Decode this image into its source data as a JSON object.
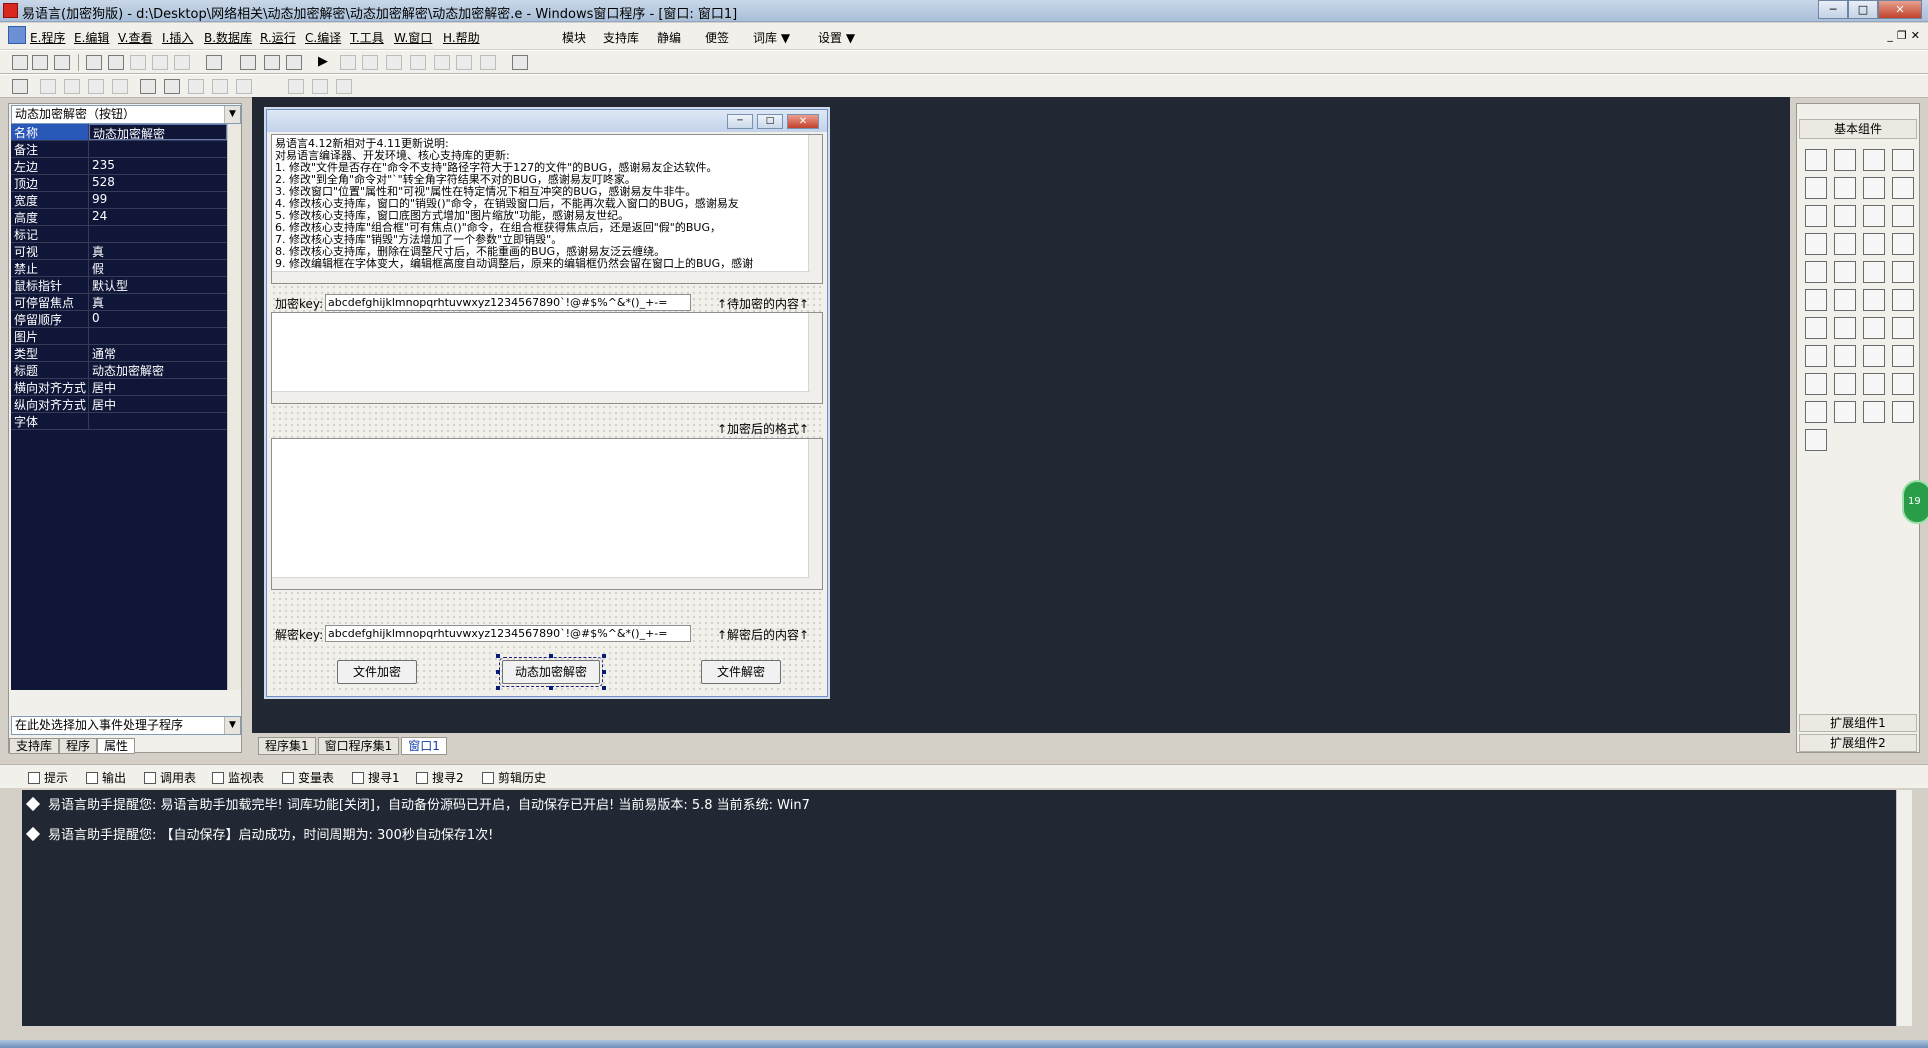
{
  "window": {
    "title": "易语言(加密狗版) - d:\\Desktop\\网络相关\\动态加密解密\\动态加密解密\\动态加密解密.e - Windows窗口程序 - [窗口: 窗口1]"
  },
  "menu": {
    "left": [
      "E.程序",
      "E.编辑",
      "V.查看",
      "I.插入",
      "B.数据库",
      "R.运行",
      "C.编译",
      "T.工具",
      "W.窗口",
      "H.帮助"
    ],
    "right": [
      "模块",
      "支持库",
      "静编",
      "便签",
      "词库 ▼",
      "设置 ▼"
    ]
  },
  "left_panel": {
    "object_select": "动态加密解密（按钮）",
    "properties": [
      {
        "name": "名称",
        "value": "动态加密解密",
        "selected": true
      },
      {
        "name": "备注",
        "value": ""
      },
      {
        "name": "左边",
        "value": "235"
      },
      {
        "name": "顶边",
        "value": "528"
      },
      {
        "name": "宽度",
        "value": "99"
      },
      {
        "name": "高度",
        "value": "24"
      },
      {
        "name": "标记",
        "value": ""
      },
      {
        "name": "可视",
        "value": "真"
      },
      {
        "name": "禁止",
        "value": "假"
      },
      {
        "name": "鼠标指针",
        "value": "默认型"
      },
      {
        "name": "可停留焦点",
        "value": "真"
      },
      {
        "name": "  停留顺序",
        "value": "0"
      },
      {
        "name": "图片",
        "value": ""
      },
      {
        "name": "类型",
        "value": "通常"
      },
      {
        "name": "标题",
        "value": "动态加密解密"
      },
      {
        "name": "横向对齐方式",
        "value": "居中"
      },
      {
        "name": "纵向对齐方式",
        "value": "居中"
      },
      {
        "name": "字体",
        "value": ""
      }
    ],
    "event_select": "在此处选择加入事件处理子程序",
    "tabs": [
      "支持库",
      "程序",
      "属性"
    ]
  },
  "form": {
    "notes_title": "易语言4.12新相对于4.11更新说明:",
    "notes_lines": [
      "",
      "对易语言编译器、开发环境、核心支持库的更新:",
      "  1. 修改\"文件是否存在\"命令不支持\"路径字符大于127的文件\"的BUG，感谢易友企达软件。",
      "  2. 修改\"到全角\"命令对\"`\"转全角字符结果不对的BUG，感谢易友叮咚家。",
      "  3. 修改窗口\"位置\"属性和\"可视\"属性在特定情况下相互冲突的BUG，感谢易友牛非牛。",
      "  4. 修改核心支持库，窗口的\"销毁()\"命令，在销毁窗口后，不能再次载入窗口的BUG，感谢易友",
      "  5. 修改核心支持库，窗口底图方式增加\"图片缩放\"功能，感谢易友世纪。",
      "  6. 修改核心支持库\"组合框\"可有焦点()\"命令，在组合框获得焦点后，还是返回\"假\"的BUG，",
      "  7. 修改核心支持库\"销毁\"方法增加了一个参数\"立即销毁\"。",
      "  8. 修改核心支持库，删除在调整尺寸后，不能重画的BUG，感谢易友泛云缠绕。",
      "  9. 修改编辑框在字体变大，编辑框高度自动调整后，原来的编辑框仍然会留在窗口上的BUG，感谢"
    ],
    "encrypt_key_label": "加密key:",
    "encrypt_key": "abcdefghijklmnopqrhtuvwxyz1234567890`!@#$%^&*()_+-=",
    "to_encrypt_label": "↑待加密的内容↑",
    "encrypted_label": "↑加密后的格式↑",
    "decrypt_key_label": "解密key:",
    "decrypt_key": "abcdefghijklmnopqrhtuvwxyz1234567890`!@#$%^&*()_+-=",
    "decrypted_label": "↑解密后的内容↑",
    "btn_file_encrypt": "文件加密",
    "btn_dynamic": "动态加密解密",
    "btn_file_decrypt": "文件解密"
  },
  "doc_tabs": [
    "程序集1",
    "窗口程序集1",
    "窗口1"
  ],
  "right_panel": {
    "header": "基本组件",
    "footer1": "扩展组件1",
    "footer2": "扩展组件2"
  },
  "output_tabs": [
    "提示",
    "输出",
    "调用表",
    "监视表",
    "变量表",
    "搜寻1",
    "搜寻2",
    "剪辑历史"
  ],
  "output_lines": [
    "易语言助手提醒您:  易语言助手加载完毕! 词库功能[关闭]，自动备份源码已开启，自动保存已开启!  当前易版本: 5.8  当前系统: Win7",
    "易语言助手提醒您: 【自动保存】启动成功，时间周期为: 300秒自动保存1次!"
  ],
  "badge": "19"
}
